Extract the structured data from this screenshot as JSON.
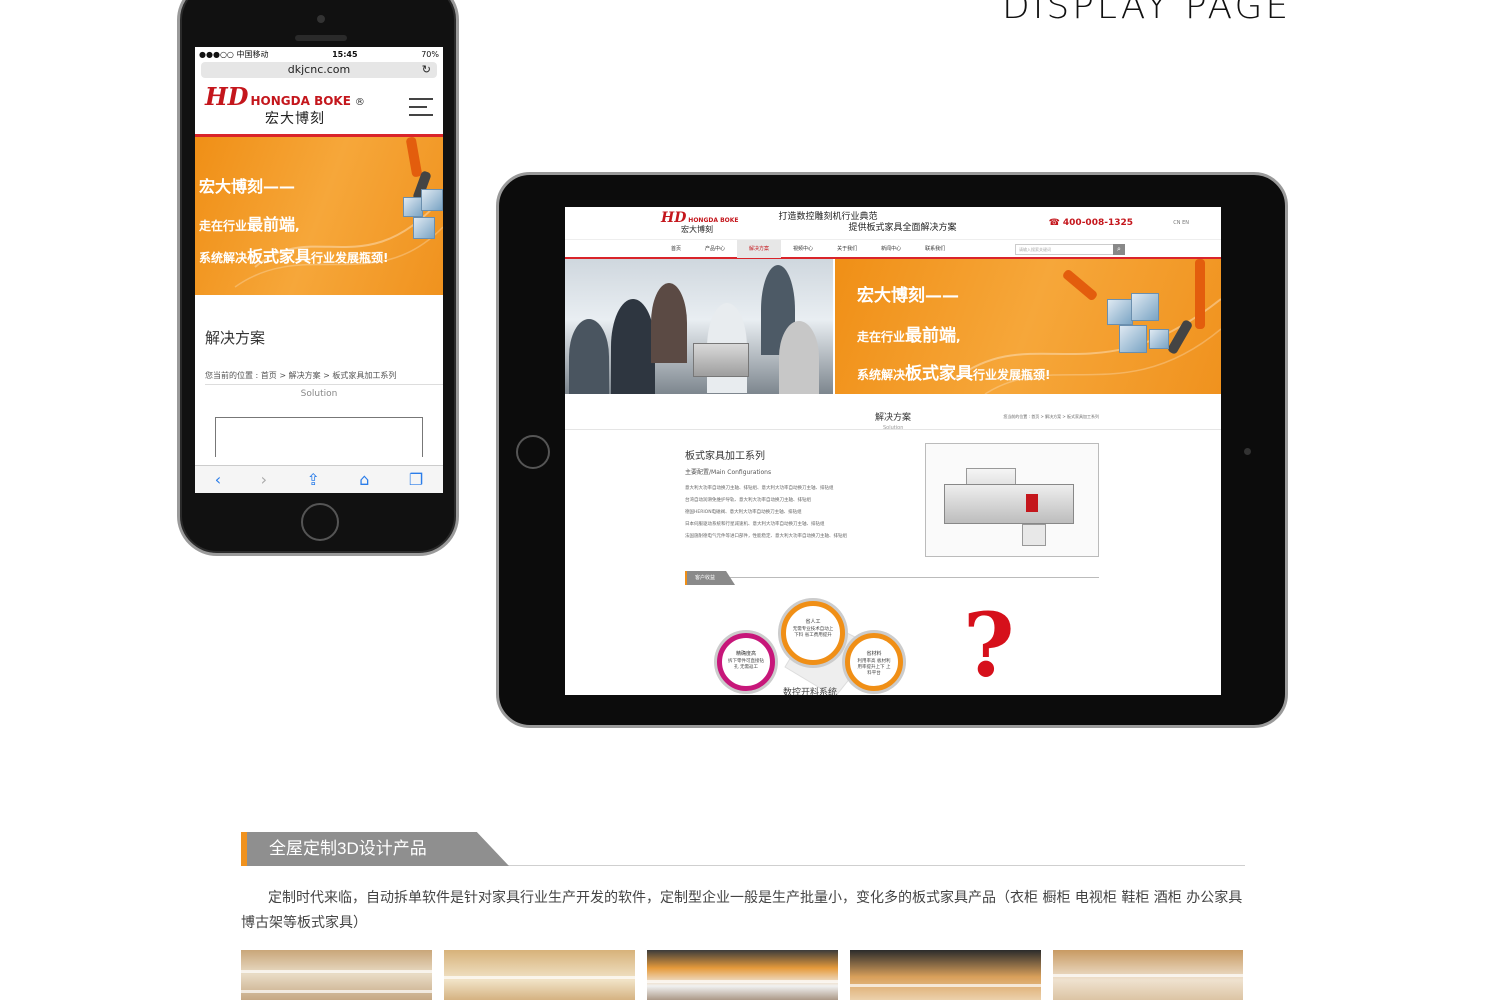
{
  "page": {
    "title": "DISPLAY PAGE"
  },
  "phone": {
    "status": {
      "carrier": "●●●○○ 中国移动 ",
      "time": "15:45",
      "battery": "70%"
    },
    "url": "dkjcnc.com",
    "logo": {
      "mark": "HD",
      "en": "HONGDA BOKE",
      "reg": "®",
      "cn": "宏大博刻"
    },
    "banner": {
      "line1": "宏大博刻——",
      "line2_a": "走在行业",
      "line2_b": "最前端",
      "line2_c": ",",
      "line3_a": "系统解决",
      "line3_b": "板式家具",
      "line3_c": "行业发展瓶颈!"
    },
    "section_title": "解决方案",
    "breadcrumb": "您当前的位置 : 首页 > 解决方案 > 板式家具加工系列",
    "subtitle": "Solution",
    "toolbar": {
      "back": "‹",
      "forward": "›",
      "share": "⇪",
      "bookmarks": "⌂",
      "tabs": "❐"
    }
  },
  "tablet": {
    "logo": {
      "mark": "HD",
      "en": "HONGDA BOKE",
      "cn": "宏大博刻"
    },
    "slogan": {
      "line1": "打造数控雕刻机行业典范",
      "line2": "提供板式家具全面解决方案"
    },
    "phone": "400-008-1325",
    "lang": "CN  EN",
    "nav": [
      {
        "label": "首页",
        "active": false
      },
      {
        "label": "产品中心",
        "active": false
      },
      {
        "label": "解决方案",
        "active": true
      },
      {
        "label": "視频中心",
        "active": false
      },
      {
        "label": "关于我们",
        "active": false
      },
      {
        "label": "新闻中心",
        "active": false
      },
      {
        "label": "联系我们",
        "active": false
      }
    ],
    "search_placeholder": "请输入搜索关键词",
    "search_icon": "⌕",
    "banner": {
      "line1": "宏大博刻——",
      "line2_a": "走在行业",
      "line2_b": "最前端",
      "line2_c": ",",
      "line3_a": "系统解决",
      "line3_b": "板式家具",
      "line3_c": "行业发展瓶颈!"
    },
    "section": {
      "title": "解决方案",
      "subtitle": "Solution",
      "breadcrumb": "您当前的位置 : 首页 > 解决方案 > 板式家具加工系列"
    },
    "product": {
      "title": "板式家具加工系列",
      "config_title": "主要配置/Main Configurations",
      "lines": [
        "意大利大功率自动换刀主轴、排钻组、意大利大功率自动换刀主轴、排钻组",
        "台湾自动润滑免维护导轨、意大利大功率自动换刀主轴、排钻组",
        "德国HERION电磁阀、意大利大功率自动换刀主轴、排钻组",
        "日本伺服驱动系统和行星减速机、意大利大功率自动换刀主轴、排钻组",
        "法国施耐德电气元件等进口部件，性能稳定、意大利大功率自动换刀主轴、排钻组"
      ]
    },
    "benefit_tab": "客户收益",
    "circles": [
      {
        "title": "省人工",
        "text": "无需专业技术自动上下料 省工费用提升"
      },
      {
        "title": "精确度高",
        "text": "拆下零件可直接钻孔 无需返工"
      },
      {
        "title": "省材料",
        "text": "利用率高 板材利用率提升上下 上料平台"
      }
    ],
    "system_label": "数控开料系统",
    "question_mark": "?"
  },
  "section3d": {
    "title": "全屋定制3D设计产品",
    "description": "定制时代来临，自动拆单软件是针对家具行业生产开发的软件，定制型企业一般是生产批量小，变化多的板式家具产品（衣柜 橱柜 电视柜 鞋柜 酒柜 办公家具 博古架等板式家具）"
  },
  "colors": {
    "accent_red": "#c4161c",
    "accent_orange": "#f0921e",
    "tab_gray": "#8f8f8f"
  }
}
